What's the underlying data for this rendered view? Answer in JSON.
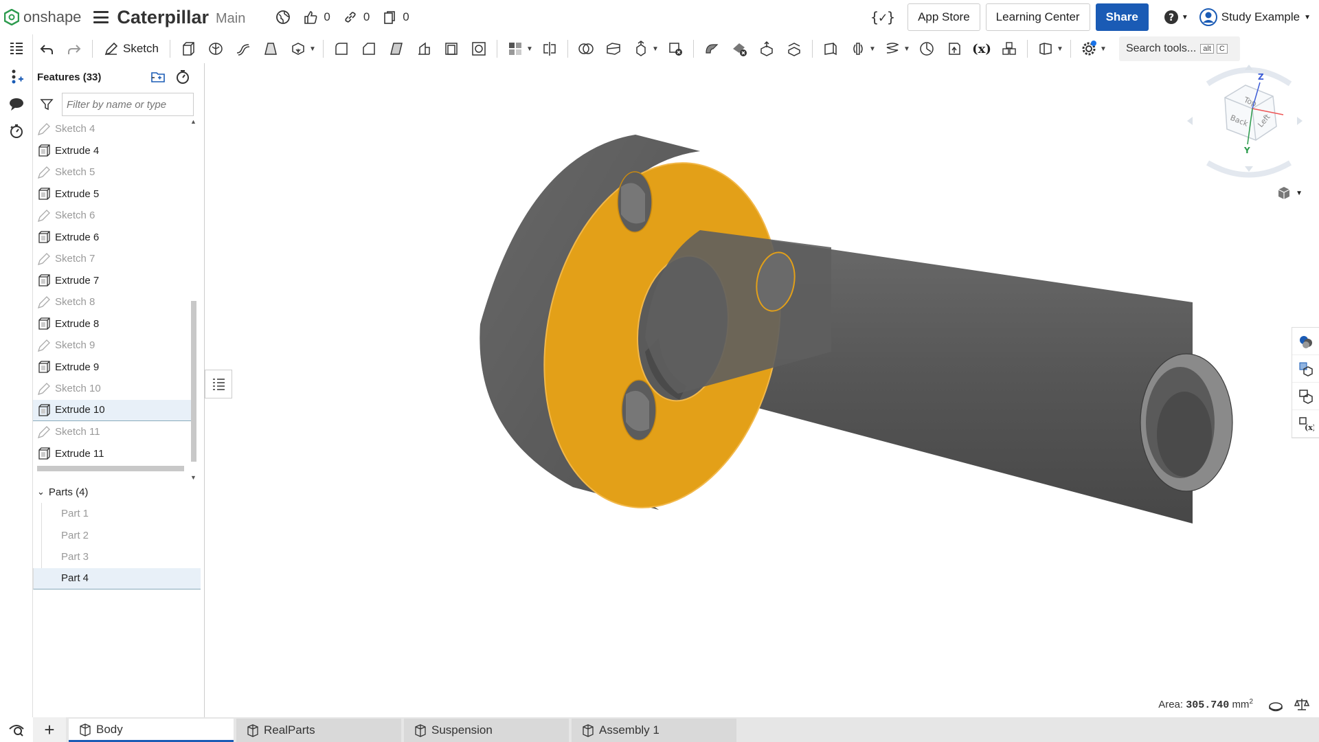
{
  "app": {
    "logo_text": "onshape"
  },
  "document": {
    "title": "Caterpillar",
    "branch": "Main"
  },
  "counts": {
    "likes": "0",
    "links": "0",
    "copies": "0"
  },
  "header_buttons": {
    "app_store": "App Store",
    "learning_center": "Learning Center",
    "share": "Share",
    "user": "Study Example"
  },
  "toolbar": {
    "sketch_label": "Sketch",
    "search_label": "Search tools...",
    "key1": "alt",
    "key2": "C"
  },
  "features": {
    "title": "Features (33)",
    "filter_placeholder": "Filter by name or type",
    "items": [
      {
        "label": "Sketch 4",
        "type": "sketch"
      },
      {
        "label": "Extrude 4",
        "type": "extrude"
      },
      {
        "label": "Sketch 5",
        "type": "sketch"
      },
      {
        "label": "Extrude 5",
        "type": "extrude"
      },
      {
        "label": "Sketch 6",
        "type": "sketch"
      },
      {
        "label": "Extrude 6",
        "type": "extrude"
      },
      {
        "label": "Sketch 7",
        "type": "sketch"
      },
      {
        "label": "Extrude 7",
        "type": "extrude"
      },
      {
        "label": "Sketch 8",
        "type": "sketch"
      },
      {
        "label": "Extrude 8",
        "type": "extrude"
      },
      {
        "label": "Sketch 9",
        "type": "sketch"
      },
      {
        "label": "Extrude 9",
        "type": "extrude"
      },
      {
        "label": "Sketch 10",
        "type": "sketch"
      },
      {
        "label": "Extrude 10",
        "type": "extrude"
      },
      {
        "label": "Sketch 11",
        "type": "sketch"
      },
      {
        "label": "Extrude 11",
        "type": "extrude"
      }
    ]
  },
  "parts": {
    "title": "Parts (4)",
    "items": [
      "Part 1",
      "Part 2",
      "Part 3",
      "Part 4"
    ]
  },
  "viewcube": {
    "top": "Top",
    "left": "Left",
    "back": "Back",
    "axis_z": "Z",
    "axis_y": "Y"
  },
  "status": {
    "area_label": "Area:",
    "area_value": "305.740",
    "area_unit": "mm",
    "area_exp": "2"
  },
  "tabs": [
    "Body",
    "RealParts",
    "Suspension",
    "Assembly 1"
  ],
  "colors": {
    "accent": "#1a5bb5",
    "highlight": "#e3a018",
    "body": "#5e5e5e"
  }
}
